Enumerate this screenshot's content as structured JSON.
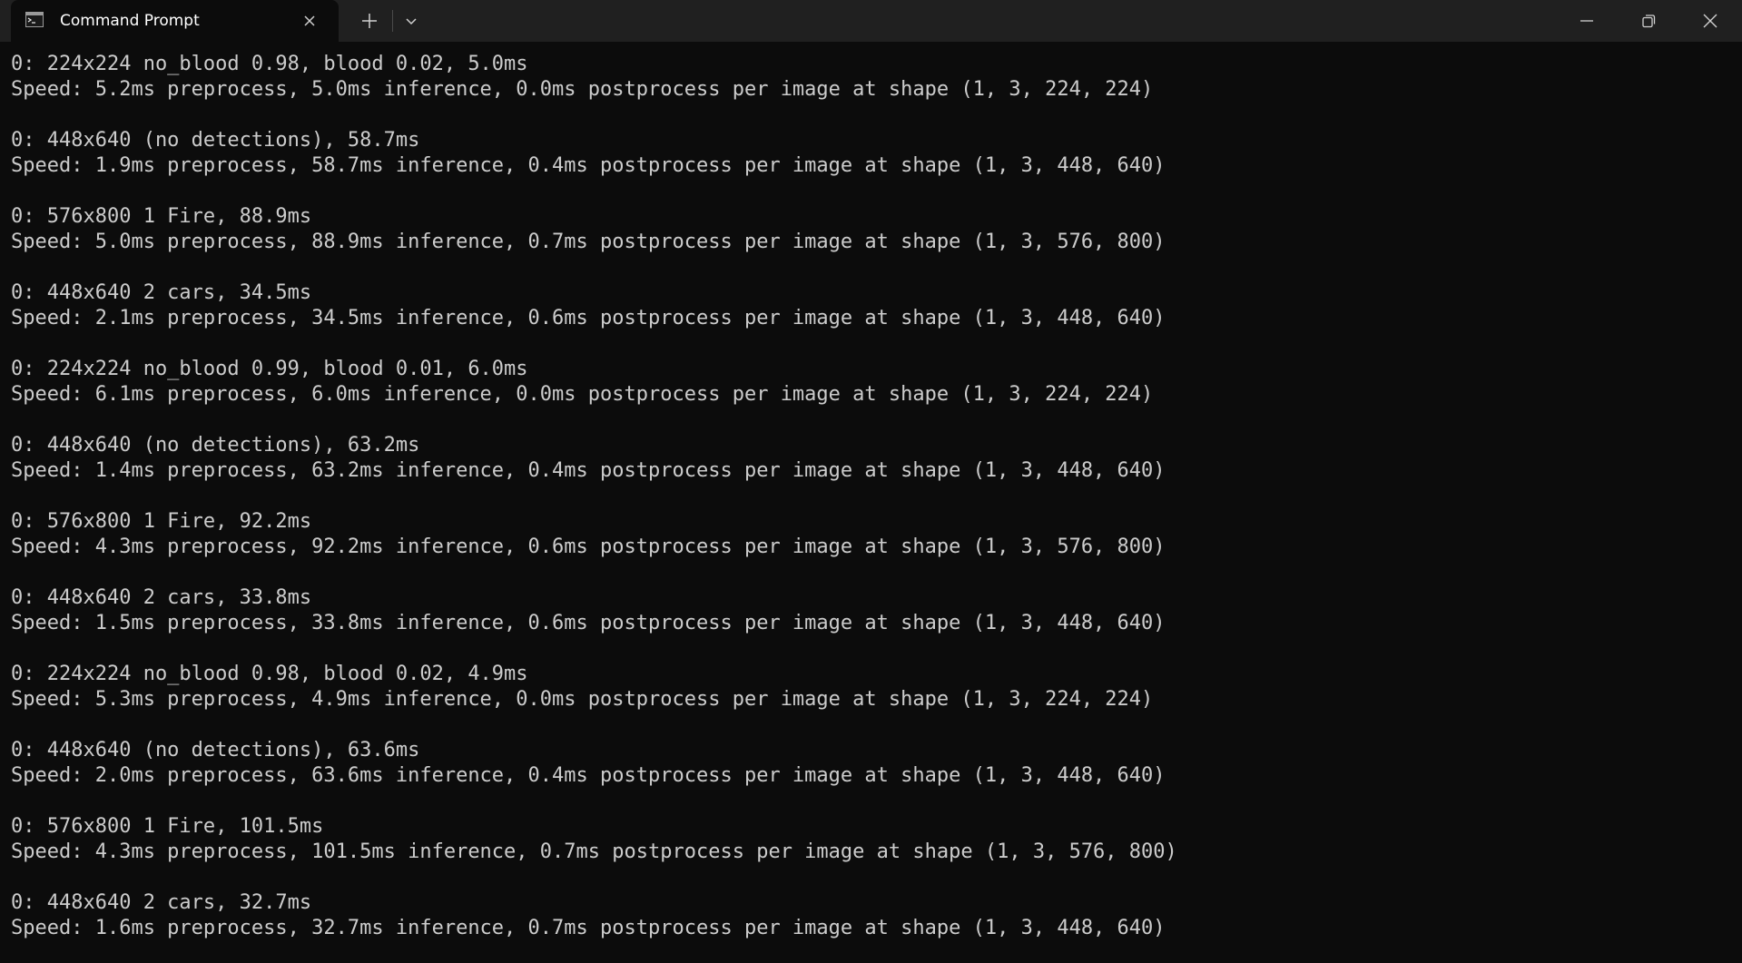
{
  "window": {
    "tab_title": "Command Prompt",
    "icons": {
      "tab": "terminal-icon",
      "close_tab": "close-icon",
      "new_tab": "plus-icon",
      "dropdown": "chevron-down-icon",
      "minimize": "minimize-icon",
      "maximize": "restore-icon",
      "close": "close-icon"
    }
  },
  "colors": {
    "background": "#0c0c0c",
    "titlebar": "#202020",
    "text": "#cccccc"
  },
  "console": {
    "lines": [
      "0: 224x224 no_blood 0.98, blood 0.02, 5.0ms",
      "Speed: 5.2ms preprocess, 5.0ms inference, 0.0ms postprocess per image at shape (1, 3, 224, 224)",
      "",
      "0: 448x640 (no detections), 58.7ms",
      "Speed: 1.9ms preprocess, 58.7ms inference, 0.4ms postprocess per image at shape (1, 3, 448, 640)",
      "",
      "0: 576x800 1 Fire, 88.9ms",
      "Speed: 5.0ms preprocess, 88.9ms inference, 0.7ms postprocess per image at shape (1, 3, 576, 800)",
      "",
      "0: 448x640 2 cars, 34.5ms",
      "Speed: 2.1ms preprocess, 34.5ms inference, 0.6ms postprocess per image at shape (1, 3, 448, 640)",
      "",
      "0: 224x224 no_blood 0.99, blood 0.01, 6.0ms",
      "Speed: 6.1ms preprocess, 6.0ms inference, 0.0ms postprocess per image at shape (1, 3, 224, 224)",
      "",
      "0: 448x640 (no detections), 63.2ms",
      "Speed: 1.4ms preprocess, 63.2ms inference, 0.4ms postprocess per image at shape (1, 3, 448, 640)",
      "",
      "0: 576x800 1 Fire, 92.2ms",
      "Speed: 4.3ms preprocess, 92.2ms inference, 0.6ms postprocess per image at shape (1, 3, 576, 800)",
      "",
      "0: 448x640 2 cars, 33.8ms",
      "Speed: 1.5ms preprocess, 33.8ms inference, 0.6ms postprocess per image at shape (1, 3, 448, 640)",
      "",
      "0: 224x224 no_blood 0.98, blood 0.02, 4.9ms",
      "Speed: 5.3ms preprocess, 4.9ms inference, 0.0ms postprocess per image at shape (1, 3, 224, 224)",
      "",
      "0: 448x640 (no detections), 63.6ms",
      "Speed: 2.0ms preprocess, 63.6ms inference, 0.4ms postprocess per image at shape (1, 3, 448, 640)",
      "",
      "0: 576x800 1 Fire, 101.5ms",
      "Speed: 4.3ms preprocess, 101.5ms inference, 0.7ms postprocess per image at shape (1, 3, 576, 800)",
      "",
      "0: 448x640 2 cars, 32.7ms",
      "Speed: 1.6ms preprocess, 32.7ms inference, 0.7ms postprocess per image at shape (1, 3, 448, 640)"
    ]
  }
}
